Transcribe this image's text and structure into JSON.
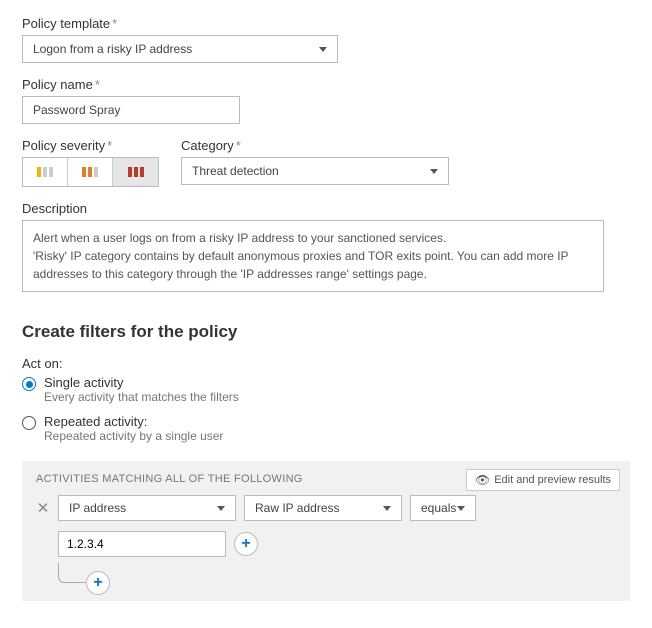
{
  "template": {
    "label": "Policy template",
    "value": "Logon from a risky IP address"
  },
  "name": {
    "label": "Policy name",
    "value": "Password Spray"
  },
  "severity": {
    "label": "Policy severity",
    "selected": "high"
  },
  "category": {
    "label": "Category",
    "value": "Threat detection"
  },
  "description": {
    "label": "Description",
    "line1": "Alert when a user logs on from a risky IP address to your sanctioned services.",
    "line2": "'Risky' IP category contains by default anonymous proxies and TOR exits point. You can add more IP addresses to this category through the 'IP addresses range' settings page."
  },
  "filters": {
    "title": "Create filters for the policy",
    "act_on_label": "Act on:",
    "single": {
      "label": "Single activity",
      "sub": "Every activity that matches the filters",
      "selected": true
    },
    "repeated": {
      "label": "Repeated activity:",
      "sub": "Repeated activity by a single user",
      "selected": false
    },
    "panel_title": "ACTIVITIES MATCHING ALL OF THE FOLLOWING",
    "preview": "Edit and preview results",
    "row1": {
      "field": "IP address",
      "subfield": "Raw IP address",
      "op": "equals",
      "value": "1.2.3.4"
    }
  }
}
